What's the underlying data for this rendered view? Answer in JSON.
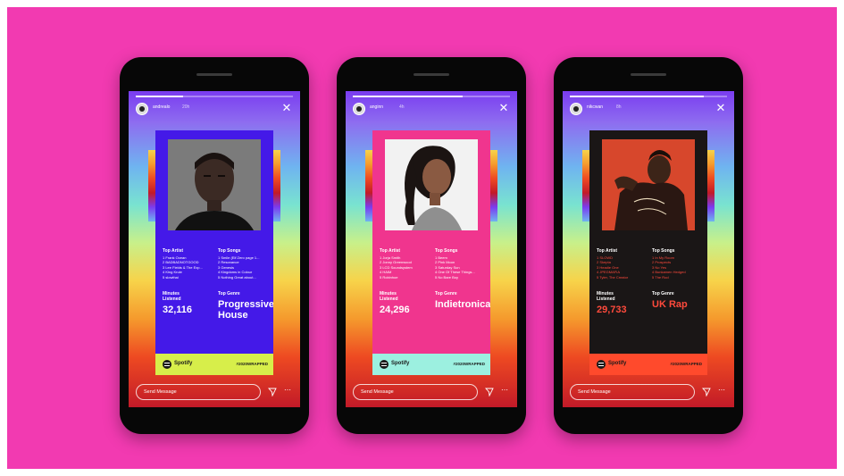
{
  "stories": [
    {
      "username": "andrealo",
      "time": "20h",
      "progress": 0.3,
      "top_artist_label": "Top Artist",
      "top_songs_label": "Top Songs",
      "top_artists": [
        "1 Frank Ocean",
        "2 BADBADNOTGOOD",
        "3 Lee Fields & The Exp...",
        "4 King Krule",
        "5 slowthai"
      ],
      "top_songs": [
        "1 Smile (Elf Zero page 1...",
        "2 Resonance",
        "3 Genesis",
        "4 Kingdoms in Colour",
        "5 Nothing Great about..."
      ],
      "minutes_label": "Minutes Listened",
      "minutes_value": "32,116",
      "genre_label": "Top Genre",
      "genre_value": "Progressive House",
      "brand": "Spotify",
      "hashtag": "#2020WRAPPED",
      "send_placeholder": "Send Message"
    },
    {
      "username": "anginn",
      "time": "4h",
      "progress": 0.7,
      "top_artist_label": "Top Artist",
      "top_songs_label": "Top Songs",
      "top_artists": [
        "1 Jorja Smith",
        "2 Jonny Greenwood",
        "3 LCD Soundsystem",
        "4 HAIM",
        "5 Robinhoe"
      ],
      "top_songs": [
        "1 Beem",
        "2 Pink Moon",
        "3 Saturday Sun",
        "4 One Of These Things...",
        "5 No Bare Boy"
      ],
      "minutes_label": "Minutes Listened",
      "minutes_value": "24,296",
      "genre_label": "Top Genre",
      "genre_value": "Indietronica",
      "brand": "Spotify",
      "hashtag": "#2020WRAPPED",
      "send_placeholder": "Send Message"
    },
    {
      "username": "nikcwan",
      "time": "8h",
      "progress": 0.85,
      "top_artist_label": "Top Artist",
      "top_songs_label": "Top Songs",
      "top_artists": [
        "1 SLOWD",
        "2 Skepta",
        "3 Headie One",
        "4 JPEGMAFIA",
        "5 Tyler, The Creator"
      ],
      "top_songs": [
        "1 In My Room",
        "2 Prospects",
        "3 No Yes",
        "4 Bunkamen Hedged",
        "5 The Rod"
      ],
      "minutes_label": "Minutes Listened",
      "minutes_value": "29,733",
      "genre_label": "Top Genre",
      "genre_value": "UK Rap",
      "brand": "Spotify",
      "hashtag": "#2020WRAPPED",
      "send_placeholder": "Send Message"
    }
  ],
  "icons": {
    "close": "close-icon",
    "direct": "direct-message-icon",
    "more": "more-icon",
    "spotify": "spotify-logo-icon"
  },
  "colors": {
    "background": "#f23ab1",
    "card_1": "#4419e8",
    "card_2": "#f0358e",
    "card_3": "#1a1616",
    "footer_1": "#d7ee4a",
    "footer_2": "#9cf0e0",
    "footer_3": "#ff4a2c",
    "accent_3": "#ff4a3c"
  }
}
